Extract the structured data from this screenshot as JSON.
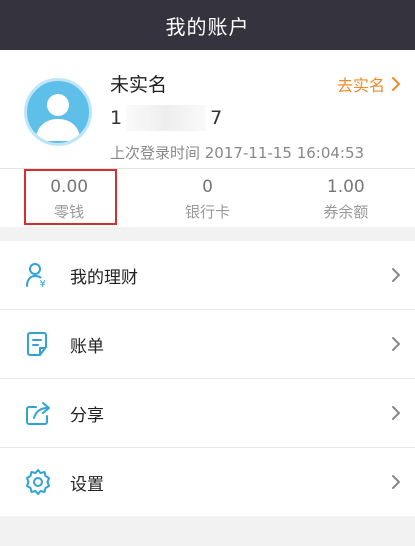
{
  "header": {
    "title": "我的账户"
  },
  "profile": {
    "name": "未实名",
    "verify_label": "去实名",
    "phone_start": "1",
    "phone_end": "7",
    "last_login": "上次登录时间 2017-11-15 16:04:53"
  },
  "stats": [
    {
      "value": "0.00",
      "label": "零钱"
    },
    {
      "value": "0",
      "label": "银行卡"
    },
    {
      "value": "1.00",
      "label": "券余额"
    }
  ],
  "menu": [
    {
      "label": "我的理财",
      "icon": "user-finance-icon"
    },
    {
      "label": "账单",
      "icon": "bill-icon"
    },
    {
      "label": "分享",
      "icon": "share-icon"
    },
    {
      "label": "设置",
      "icon": "gear-icon"
    }
  ],
  "colors": {
    "header_bg": "#35333d",
    "accent_orange": "#f08a2a",
    "icon_blue": "#2fa3d6",
    "highlight_red": "#d32f2f"
  }
}
